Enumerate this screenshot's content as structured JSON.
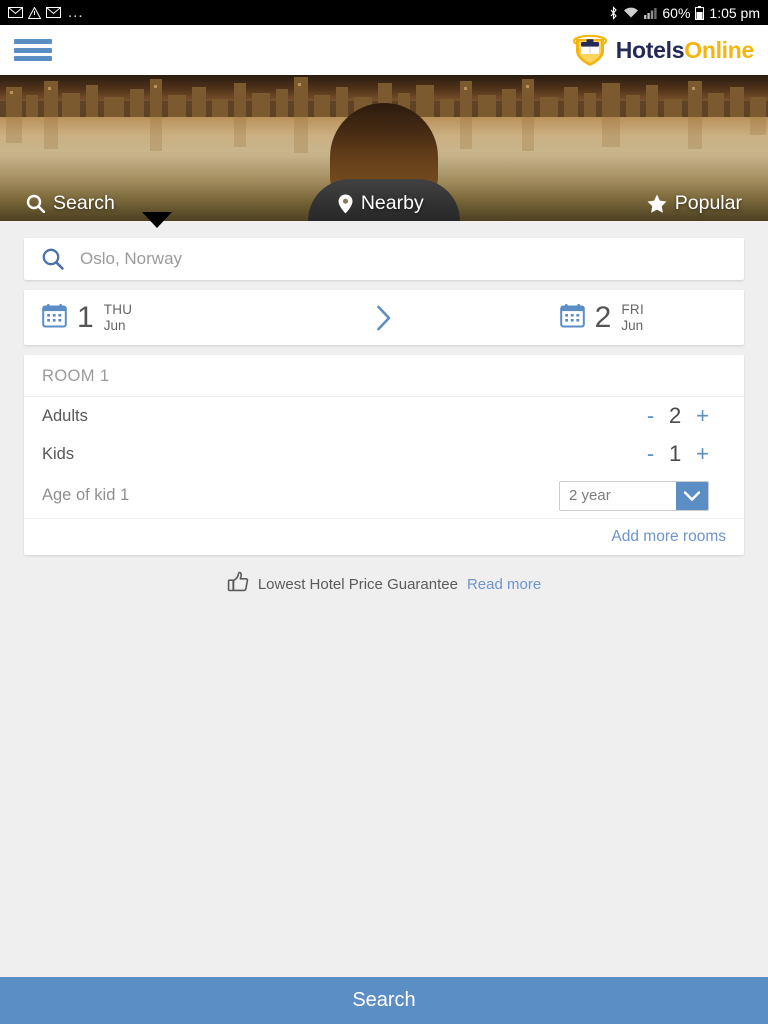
{
  "statusbar": {
    "icons": [
      "mail-icon",
      "warning-triangle-icon",
      "mail-icon"
    ],
    "overflow": "...",
    "right_icons": [
      "bluetooth-icon",
      "wifi-icon",
      "cell-signal-icon"
    ],
    "battery_percent": "60%",
    "time": "1:05 pm"
  },
  "header": {
    "menu_icon": "hamburger-menu-icon",
    "logo_primary": "Hotels",
    "logo_secondary": "Online"
  },
  "hero": {
    "tabs": [
      {
        "label": "Search",
        "icon": "search-icon",
        "active": true
      },
      {
        "label": "Nearby",
        "icon": "map-pin-icon",
        "active": false
      },
      {
        "label": "Popular",
        "icon": "star-icon",
        "active": false
      }
    ]
  },
  "search": {
    "icon": "search-icon",
    "value": "Oslo, Norway",
    "placeholder": "Oslo, Norway"
  },
  "dates": {
    "checkin": {
      "day": "1",
      "weekday": "THU",
      "month": "Jun",
      "icon": "calendar-icon"
    },
    "checkout": {
      "day": "2",
      "weekday": "FRI",
      "month": "Jun",
      "icon": "calendar-icon"
    },
    "separator_icon": "chevron-right-icon"
  },
  "room": {
    "title": "ROOM 1",
    "adults": {
      "label": "Adults",
      "value": "2",
      "minus": "-",
      "plus": "+"
    },
    "kids": {
      "label": "Kids",
      "value": "1",
      "minus": "-",
      "plus": "+"
    },
    "kid_age": {
      "label": "Age of kid 1",
      "value": "2 year",
      "dropdown_icon": "chevron-down-icon"
    },
    "add_more_rooms": "Add more rooms"
  },
  "guarantee": {
    "icon": "thumbs-up-icon",
    "text": "Lowest Hotel Price Guarantee",
    "link": "Read more"
  },
  "footer": {
    "search_button": "Search"
  },
  "colors": {
    "accent_blue": "#5b8ec4",
    "link_blue": "#6d95c9",
    "logo_navy": "#242a56",
    "logo_gold": "#f4b60e",
    "page_bg": "#efefef"
  }
}
